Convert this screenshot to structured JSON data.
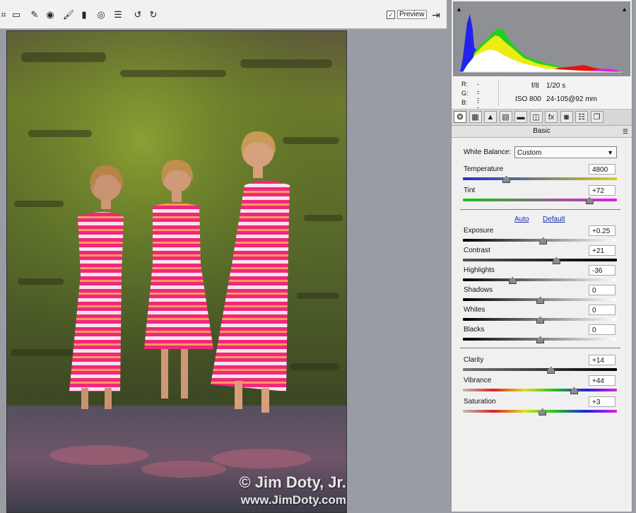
{
  "toolbar": {
    "tools": [
      {
        "icon": "crop-icon",
        "glyph": "⌗"
      },
      {
        "icon": "straighten-icon",
        "glyph": "▭"
      },
      {
        "icon": "spot-removal-icon",
        "glyph": "✎"
      },
      {
        "icon": "red-eye-icon",
        "glyph": "◉"
      },
      {
        "icon": "adjustment-brush-icon",
        "glyph": "🖌"
      },
      {
        "icon": "graduated-filter-icon",
        "glyph": "▮"
      },
      {
        "icon": "radial-filter-icon",
        "glyph": "◎"
      },
      {
        "icon": "preferences-list-icon",
        "glyph": "☰"
      },
      {
        "icon": "rotate-left-icon",
        "glyph": "↺"
      },
      {
        "icon": "rotate-right-icon",
        "glyph": "↻"
      }
    ],
    "preview_label": "Preview",
    "preview_checked": true
  },
  "photo": {
    "watermark_line1": "© Jim Doty, Jr.",
    "watermark_line2": "www.JimDoty.com"
  },
  "histogram": {
    "colors": {
      "blue": "#1010ee",
      "green": "#22d622",
      "yellow": "#f0f000",
      "red": "#ee1010",
      "magenta": "#e020e0",
      "white": "#ffffff"
    }
  },
  "readout": {
    "r_label": "R:",
    "r_value": "---",
    "g_label": "G:",
    "g_value": "---",
    "b_label": "B:",
    "b_value": "---",
    "aperture": "f/8",
    "shutter": "1/20 s",
    "iso": "ISO 800",
    "lens": "24-105@92 mm"
  },
  "panel_tabs": [
    {
      "icon": "basic-tab-icon",
      "glyph": "❂"
    },
    {
      "icon": "tone-curve-tab-icon",
      "glyph": "▦"
    },
    {
      "icon": "detail-tab-icon",
      "glyph": "▲"
    },
    {
      "icon": "hsl-tab-icon",
      "glyph": "▤"
    },
    {
      "icon": "split-toning-tab-icon",
      "glyph": "▬"
    },
    {
      "icon": "lens-corrections-tab-icon",
      "glyph": "◫"
    },
    {
      "icon": "effects-tab-icon",
      "glyph": "fx"
    },
    {
      "icon": "camera-calibration-tab-icon",
      "glyph": "◙"
    },
    {
      "icon": "presets-tab-icon",
      "glyph": "☷"
    },
    {
      "icon": "snapshots-tab-icon",
      "glyph": "❐"
    }
  ],
  "panel": {
    "title": "Basic",
    "white_balance_label": "White Balance:",
    "white_balance_value": "Custom",
    "auto_label": "Auto",
    "default_label": "Default"
  },
  "sliders": {
    "temperature": {
      "label": "Temperature",
      "value": "4800",
      "fraction": 0.28
    },
    "tint": {
      "label": "Tint",
      "value": "+72",
      "fraction": 0.82
    },
    "exposure": {
      "label": "Exposure",
      "value": "+0.25",
      "fraction": 0.52
    },
    "contrast": {
      "label": "Contrast",
      "value": "+21",
      "fraction": 0.605
    },
    "highlights": {
      "label": "Highlights",
      "value": "-36",
      "fraction": 0.32
    },
    "shadows": {
      "label": "Shadows",
      "value": "0",
      "fraction": 0.5
    },
    "whites": {
      "label": "Whites",
      "value": "0",
      "fraction": 0.5
    },
    "blacks": {
      "label": "Blacks",
      "value": "0",
      "fraction": 0.5
    },
    "clarity": {
      "label": "Clarity",
      "value": "+14",
      "fraction": 0.57
    },
    "vibrance": {
      "label": "Vibrance",
      "value": "+44",
      "fraction": 0.72
    },
    "saturation": {
      "label": "Saturation",
      "value": "+3",
      "fraction": 0.515
    }
  }
}
